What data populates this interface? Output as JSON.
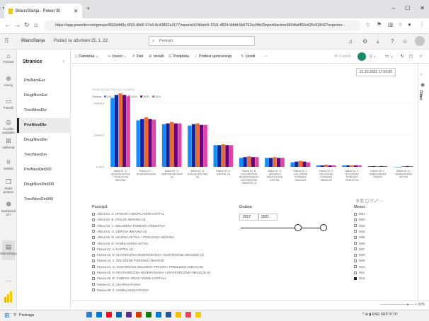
{
  "browser": {
    "tab_title": "BilansStanja - Power BI",
    "url": "https://app.powerbi.com/groups/f602d440c-6f18-40d5-97e6-8c43802a2177/reports/d7d0afc0-1591-4824-9d9d-5b6752ec5ffc/ReportSection482dfa6f50e435c53842?experien..."
  },
  "header": {
    "report_name": "BilansStanja",
    "updated": "Podaci su ažurirani 25. 1. 22.",
    "search_placeholder": "Pretraži"
  },
  "rail": [
    {
      "label": "Početak",
      "icon": "home-icon"
    },
    {
      "label": "Kreiraj",
      "icon": "plus-icon"
    },
    {
      "label": "Pretraži",
      "icon": "folder-icon"
    },
    {
      "label": "Čvorište podataka",
      "icon": "datahub-icon"
    },
    {
      "label": "Aplikacije",
      "icon": "apps-icon"
    },
    {
      "label": "Metrika",
      "icon": "trophy-icon"
    },
    {
      "label": "Radni prostori",
      "icon": "workspaces-icon"
    },
    {
      "label": "Dashboard 1GY",
      "icon": "dashboard-icon"
    },
    {
      "label": "BilansStanja",
      "icon": "report-icon"
    }
  ],
  "pages": {
    "title": "Stranice",
    "items": [
      "PrviNivoEur",
      "DrugiNivoEur",
      "TreciNivoEur",
      "PrviNivoDin",
      "DrugiNivoDin",
      "TreciNivoDin",
      "PrviNivoDin000",
      "DrugiNivoDin000",
      "TreciNivoDin000"
    ],
    "active": "PrviNivoDin"
  },
  "toolbar": {
    "datoteka": "Datoteka",
    "izvezi": "Izvezi",
    "deli": "Deli",
    "istrazi": "Istraži",
    "pretplata": "Pretplata",
    "upozorenje": "Podesi upozorenje",
    "uredi": "Uredi",
    "more": "···",
    "copilot": "Copilot"
  },
  "timestamp": "21.10.2021 17:59:55",
  "filters_label": "Filteri",
  "chart_data": {
    "type": "bar",
    "title": "Vrednosti po Pozicija i Godina",
    "legend_label": "Godina",
    "series": [
      {
        "name": "2017",
        "color": "#118dff",
        "values": [
          92,
          62,
          57,
          55,
          29,
          12,
          12,
          6,
          2,
          2,
          1,
          0
        ]
      },
      {
        "name": "2018",
        "color": "#12239e",
        "values": [
          96,
          64,
          58,
          57,
          29,
          13,
          12,
          7,
          2,
          2,
          1,
          0
        ]
      },
      {
        "name": "2019",
        "color": "#e66c37",
        "values": [
          98,
          66,
          60,
          58,
          30,
          14,
          13,
          8,
          3,
          2,
          1,
          1
        ]
      },
      {
        "name": "2020",
        "color": "#6b007b",
        "values": [
          96,
          64,
          58,
          56,
          29,
          13,
          12,
          7,
          2,
          2,
          1,
          1
        ]
      },
      {
        "name": "2021",
        "color": "#e044a7",
        "values": [
          94,
          63,
          58,
          56,
          29,
          13,
          12,
          6,
          2,
          2,
          1,
          1
        ]
      }
    ],
    "categories": [
      "Aktiva 01. II. UKUPNA AKTIVA = POSLOVNA IMOVINA",
      "Pasiva 07. I. UKUPNA PASIVA",
      "Aktiva 04. G. OBRTNA IMOVINA (4)",
      "Aktiva 02. B. STALNA IMOVINA (4)",
      "Pasiva 01. A. KAPITAL (4)",
      "Pasiva 02. B. DUGOROČNA REZERVISANJA I DUGOROČNE OBAVEZE (4)",
      "Aktiva 01. A. UPISANI A NEUPLAĆENI KAPITAL",
      "Pasiva 03. V. ODLOŽENE PORESKE OBAVEZE",
      "Pasiva 03. V. ODLOŽENE PORESKE OBAVEZE",
      "Aktiva 03. V. ODLOŽENA PORESKA SREDSTVA",
      "Pasiva 08. Z. VANBILANSNA PASIVA",
      "Aktiva 06. D. VANBILANSNA AKTIVA"
    ],
    "ylim": [
      0,
      100
    ],
    "yticks": [
      "200mlrd.",
      "100mlrd.",
      "0 mlrd."
    ]
  },
  "slicers": {
    "pozicija": {
      "title": "Pozicija1",
      "items": [
        "Aktiva 01. A. UPISANI A NEUPLAĆENI KAPITAL",
        "Aktiva 02. B. STALNA IMOVINA (4)",
        "Aktiva 03. V. ODLOŽENA PORESKA SREDSTVA",
        "Aktiva 04. G. OBRTNA IMOVINA (4)",
        "Aktiva 05. D. UKUPNA AKTIVA = POSLOVNA IMOVINA",
        "Aktiva 06. Đ. VANBILANSNA AKTIVA",
        "Pasiva 01. A. KAPITAL (4)",
        "Pasiva 02. B. DUGOROČNA REZERVISANJA I DUGOROČNE OBAVEZE (4)",
        "Pasiva 03. V. ODLOŽENE PORESKE OBAVEZE",
        "Pasiva 04. G. DUGOROČNI ODLOŽENI PRIHODI I PRIMLJENE DONACIJE",
        "Pasiva 05. D. KRATKOROČNA REZERVISANJA I KRATKOROČNE OBAVEZE (4)",
        "Pasiva 06. Đ. GUBITAK IZNAD VISINE KAPITALA",
        "Pasiva 07. E. UKUPNA PASIVA",
        "Pasiva 08. Ž. VANBILANSNA PASIVA"
      ]
    },
    "godina": {
      "title": "Godina",
      "from": "2017",
      "to": "2021"
    },
    "mjesec": {
      "title": "Mesec",
      "items": [
        "M01",
        "M02",
        "M03",
        "M04",
        "M05",
        "M06",
        "M07",
        "M08",
        "M09",
        "M10",
        "M11",
        "M12"
      ],
      "checked": "M12"
    }
  },
  "zoom": "- ──────────●── + 93%",
  "taskbar": {
    "search": "Pretraga",
    "tray": "^ ⊕ ▮ ENG SRP 07:07"
  }
}
